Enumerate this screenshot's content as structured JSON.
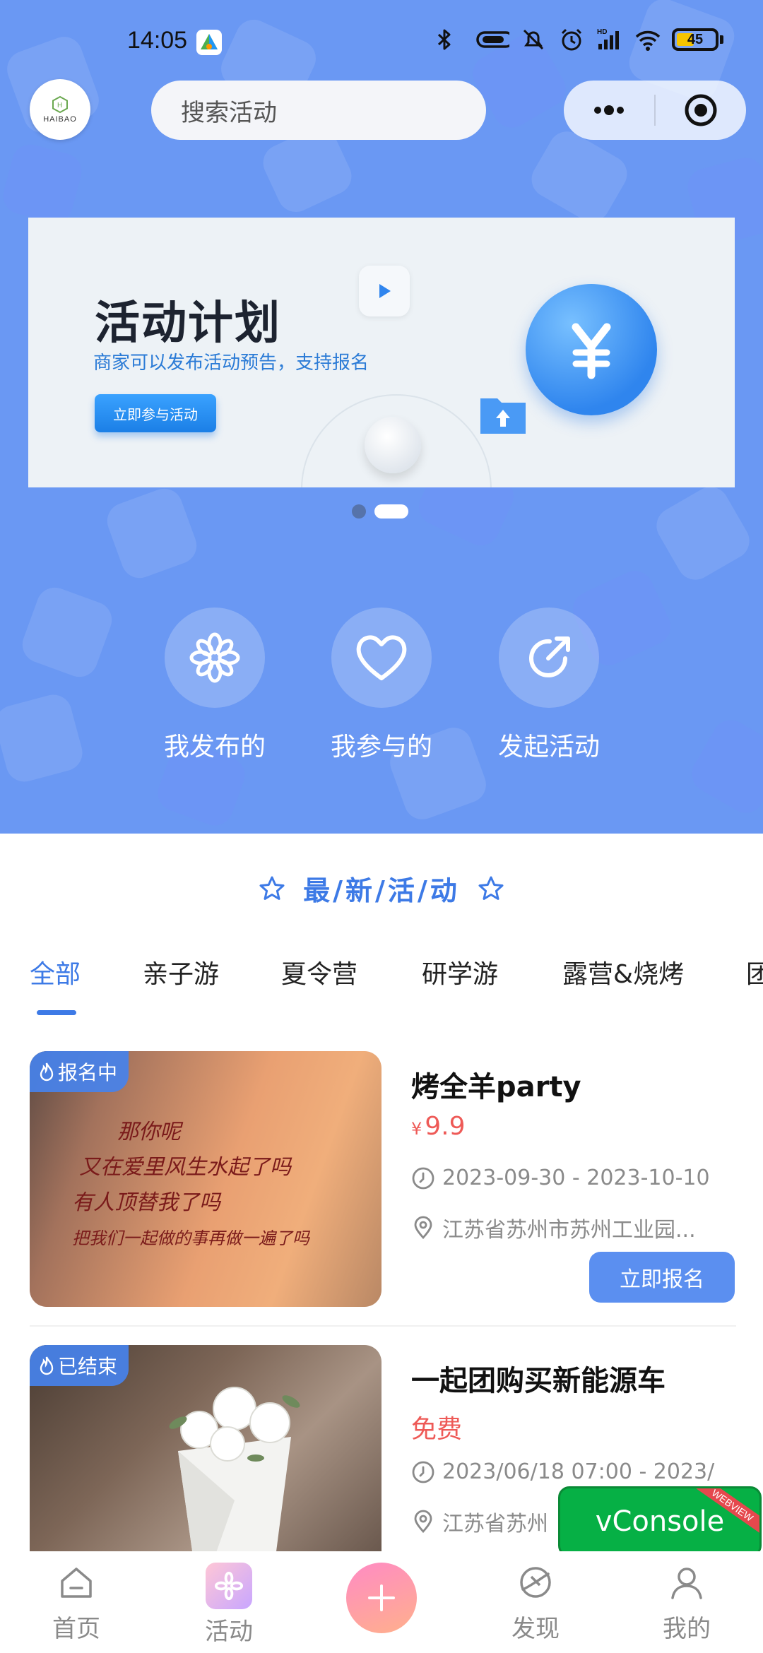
{
  "status_bar": {
    "time": "14:05",
    "battery": "45"
  },
  "header": {
    "logo_text": "HAIBAO",
    "search_placeholder": "搜索活动"
  },
  "banner": {
    "title": "活动计划",
    "subtitle": "商家可以发布活动预告，支持报名",
    "button": "立即参与活动",
    "page_count": 2,
    "active_index": 1
  },
  "quick_actions": [
    {
      "label": "我发布的",
      "icon": "flower-icon"
    },
    {
      "label": "我参与的",
      "icon": "heart-icon"
    },
    {
      "label": "发起活动",
      "icon": "share-icon"
    }
  ],
  "section": {
    "title": "最/新/活/动"
  },
  "tabs": [
    "全部",
    "亲子游",
    "夏令营",
    "研学游",
    "露营&烧烤",
    "团"
  ],
  "active_tab": 0,
  "activities": [
    {
      "status": "报名中",
      "title": "烤全羊party",
      "price_symbol": "¥",
      "price": "9.9",
      "time": "2023-09-30 - 2023-10-10",
      "location": "江苏省苏州市苏州工业园...",
      "button": "立即报名",
      "image_text": [
        "那你呢",
        "又在爱里风生水起了吗",
        "有人顶替我了吗",
        "把我们一起做的事再做一遍了吗"
      ]
    },
    {
      "status": "已结束",
      "title": "一起团购买新能源车",
      "price": "免费",
      "time": "2023/06/18 07:00 - 2023/",
      "location": "江苏省苏州"
    }
  ],
  "vconsole": {
    "label": "vConsole",
    "tag": "WEBVIEW"
  },
  "bottom_nav": [
    {
      "label": "首页",
      "icon": "home-icon"
    },
    {
      "label": "活动",
      "icon": "activity-icon"
    },
    {
      "label": "",
      "icon": "plus-icon"
    },
    {
      "label": "发现",
      "icon": "discover-icon"
    },
    {
      "label": "我的",
      "icon": "profile-icon"
    }
  ],
  "colors": {
    "header_bg": "#6a98f3",
    "accent": "#3d7ae6",
    "price": "#ee5a57",
    "button": "#5b8ff0",
    "vconsole": "#06b045"
  }
}
